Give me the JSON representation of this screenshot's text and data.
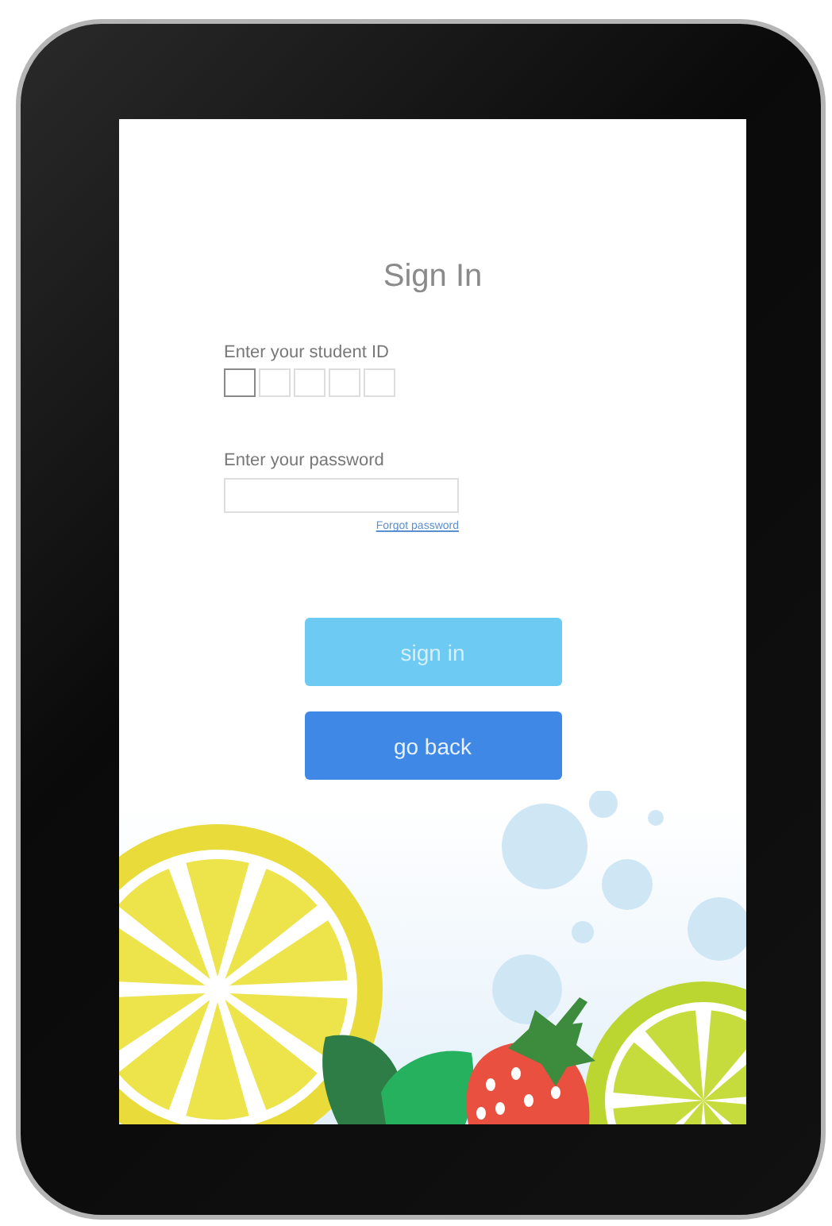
{
  "screen": {
    "title": "Sign In",
    "student_id": {
      "label": "Enter your student ID",
      "boxes": [
        {
          "focused": true
        },
        {
          "focused": false
        },
        {
          "focused": false
        },
        {
          "focused": false
        },
        {
          "focused": false
        }
      ]
    },
    "password": {
      "label": "Enter your password"
    },
    "forgot_link": "Forgot password",
    "buttons": [
      {
        "label": "sign in",
        "disabled": true
      },
      {
        "label": "go back",
        "disabled": false
      }
    ]
  }
}
